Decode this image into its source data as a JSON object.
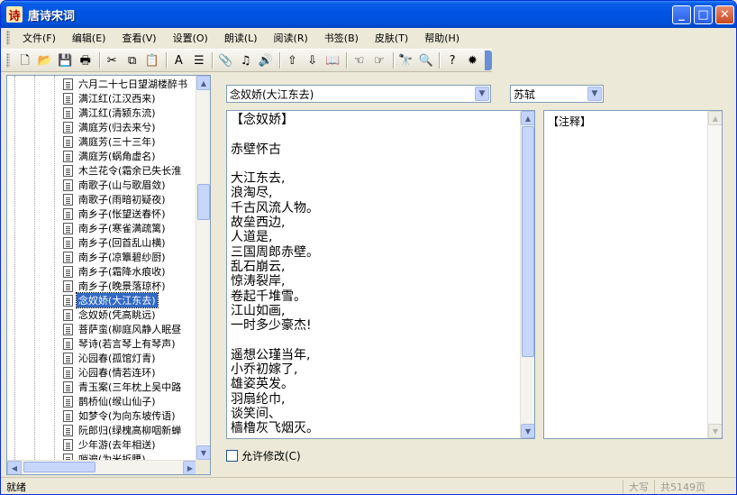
{
  "window": {
    "app_icon_glyph": "诗",
    "title": "唐诗宋词",
    "minimize_glyph": "_",
    "maximize_glyph": "□",
    "close_glyph": "✕"
  },
  "menu": [
    "文件(F)",
    "编辑(E)",
    "查看(V)",
    "设置(O)",
    "朗读(L)",
    "阅读(R)",
    "书签(B)",
    "皮肤(T)",
    "帮助(H)"
  ],
  "toolbar": {
    "icons": [
      {
        "name": "new-icon",
        "glyph": "🗋"
      },
      {
        "name": "open-folder-icon",
        "glyph": "📂"
      },
      {
        "name": "save-icon",
        "glyph": "💾"
      },
      {
        "name": "print-icon",
        "glyph": "🖶"
      },
      {
        "sep": true
      },
      {
        "name": "cut-icon",
        "glyph": "✂"
      },
      {
        "name": "copy-icon",
        "glyph": "⧉"
      },
      {
        "name": "paste-icon",
        "glyph": "📋"
      },
      {
        "sep": true
      },
      {
        "name": "font-color-icon",
        "glyph": "A"
      },
      {
        "name": "format-icon",
        "glyph": "☰"
      },
      {
        "sep": true
      },
      {
        "name": "paperclip-icon",
        "glyph": "📎"
      },
      {
        "name": "read-icon",
        "glyph": "♫"
      },
      {
        "name": "speaker-icon",
        "glyph": "🔊"
      },
      {
        "sep": true
      },
      {
        "name": "arrow-up-icon",
        "glyph": "⇧"
      },
      {
        "name": "arrow-down-icon",
        "glyph": "⇩"
      },
      {
        "name": "book-icon",
        "glyph": "📖"
      },
      {
        "sep": true
      },
      {
        "name": "point-left-icon",
        "glyph": "☜"
      },
      {
        "name": "point-right-icon",
        "glyph": "☞"
      },
      {
        "sep": true
      },
      {
        "name": "find-icon",
        "glyph": "🔭"
      },
      {
        "name": "search-icon",
        "glyph": "🔍"
      },
      {
        "sep": true
      },
      {
        "name": "help-icon",
        "glyph": "?"
      },
      {
        "name": "about-icon",
        "glyph": "✹"
      }
    ]
  },
  "tree": {
    "items": [
      "六月二十七日望湖楼醉书",
      "满江红(江汉西来)",
      "满江红(清颍东流)",
      "满庭芳(归去来兮)",
      "满庭芳(三十三年)",
      "满庭芳(蜗角虚名)",
      "木兰花令(霜余已失长淮",
      "南歌子(山与歌眉敛)",
      "南歌子(雨暗初疑夜)",
      "南乡子(怅望送春怀)",
      "南乡子(寒雀满疏篱)",
      "南乡子(回首乱山横)",
      "南乡子(凉簟碧纱厨)",
      "南乡子(霜降水痕收)",
      "南乡子(晚景落琼杯)",
      "念奴娇(大江东去)",
      "念奴娇(凭高眺远)",
      "菩萨蛮(柳庭风静人眠昼",
      "琴诗(若言琴上有琴声)",
      "沁园春(孤馆灯青)",
      "沁园春(情若连环)",
      "青玉案(三年枕上吴中路",
      "鹊桥仙(缑山仙子)",
      "如梦令(为向东坡传语)",
      "阮郎归(绿槐高柳咽新蝉",
      "少年游(去年相送)",
      "哨遍(为米折腰)"
    ],
    "selected_index": 15
  },
  "title_combo": {
    "value": "念奴娇(大江东去)"
  },
  "author_combo": {
    "value": "苏轼"
  },
  "poem_text": "【念奴娇】\n\n赤壁怀古\n\n大江东去,\n浪淘尽,\n千古风流人物。\n故垒西边,\n人道是,\n三国周郎赤壁。\n乱石崩云,\n惊涛裂岸,\n卷起千堆雪。\n江山如画,\n一时多少豪杰!\n\n遥想公瑾当年,\n小乔初嫁了,\n雄姿英发。\n羽扇纶巾,\n谈笑间、\n樯橹灰飞烟灭。",
  "notes_title": "【注释】",
  "allow_edit": {
    "label": "允许修改(C)",
    "checked": false
  },
  "status": {
    "left": "就绪",
    "caps": "大写",
    "count": "共5149页"
  }
}
